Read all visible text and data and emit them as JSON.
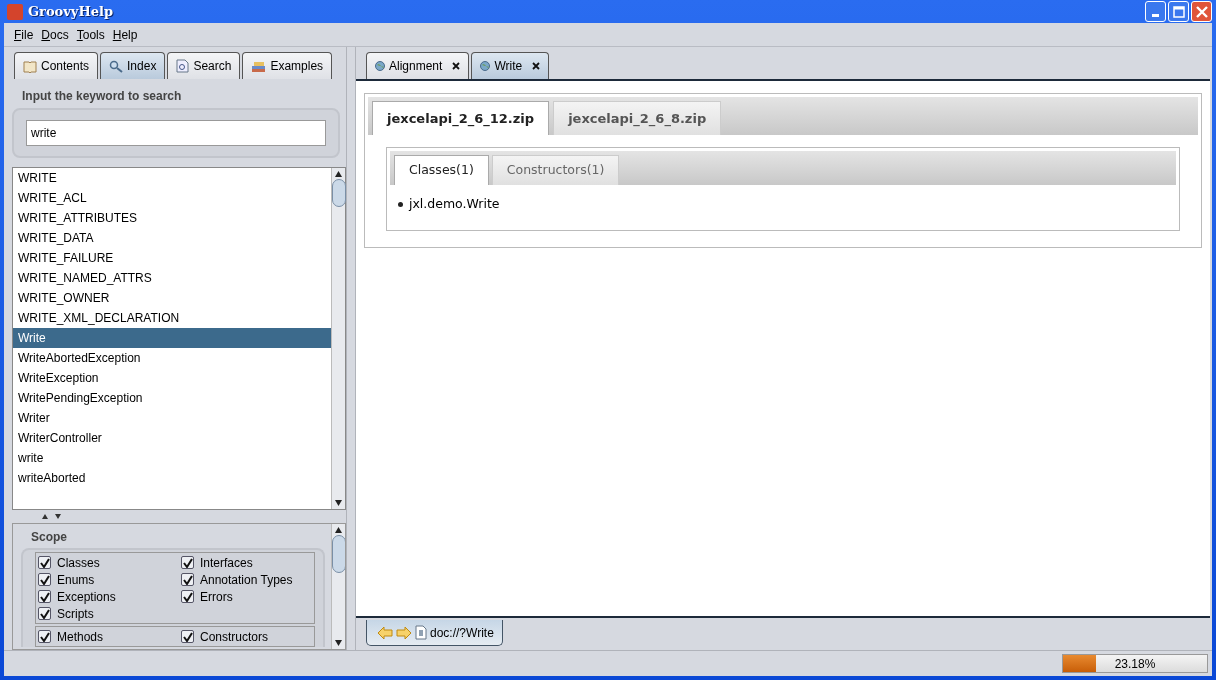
{
  "window": {
    "title": "GroovyHelp"
  },
  "menu": [
    {
      "label": "File"
    },
    {
      "label": "Docs"
    },
    {
      "label": "Tools"
    },
    {
      "label": "Help"
    }
  ],
  "left_tabs": [
    {
      "label": "Contents",
      "selected": false
    },
    {
      "label": "Index",
      "selected": true
    },
    {
      "label": "Search",
      "selected": false
    },
    {
      "label": "Examples",
      "selected": false
    }
  ],
  "search": {
    "label": "Input the keyword to search",
    "value": "write"
  },
  "results": [
    {
      "label": "WRITE",
      "selected": false
    },
    {
      "label": "WRITE_ACL",
      "selected": false
    },
    {
      "label": "WRITE_ATTRIBUTES",
      "selected": false
    },
    {
      "label": "WRITE_DATA",
      "selected": false
    },
    {
      "label": "WRITE_FAILURE",
      "selected": false
    },
    {
      "label": "WRITE_NAMED_ATTRS",
      "selected": false
    },
    {
      "label": "WRITE_OWNER",
      "selected": false
    },
    {
      "label": "WRITE_XML_DECLARATION",
      "selected": false
    },
    {
      "label": "Write",
      "selected": true
    },
    {
      "label": "WriteAbortedException",
      "selected": false
    },
    {
      "label": "WriteException",
      "selected": false
    },
    {
      "label": "WritePendingException",
      "selected": false
    },
    {
      "label": "Writer",
      "selected": false
    },
    {
      "label": "WriterController",
      "selected": false
    },
    {
      "label": "write",
      "selected": false
    },
    {
      "label": "writeAborted",
      "selected": false
    }
  ],
  "scope": {
    "label": "Scope",
    "groups": [
      [
        {
          "label": "Classes",
          "checked": true
        },
        {
          "label": "Interfaces",
          "checked": true
        },
        {
          "label": "Enums",
          "checked": true
        },
        {
          "label": "Annotation Types",
          "checked": true
        },
        {
          "label": "Exceptions",
          "checked": true
        },
        {
          "label": "Errors",
          "checked": true
        },
        {
          "label": "Scripts",
          "checked": true
        }
      ],
      [
        {
          "label": "Methods",
          "checked": true
        },
        {
          "label": "Constructors",
          "checked": true
        }
      ]
    ]
  },
  "doc_tabs": [
    {
      "label": "Alignment",
      "selected": false
    },
    {
      "label": "Write",
      "selected": true
    }
  ],
  "package_tabs": [
    {
      "label": "jexcelapi_2_6_12.zip",
      "selected": true
    },
    {
      "label": "jexcelapi_2_6_8.zip",
      "selected": false
    }
  ],
  "member_tabs": [
    {
      "label": "Classes(1)",
      "selected": true
    },
    {
      "label": "Constructors(1)",
      "selected": false
    }
  ],
  "members": [
    "jxl.demo.Write"
  ],
  "address": {
    "url": "doc://?Write"
  },
  "status_bar": {
    "progress": {
      "level": 0.2318,
      "reading": "23.18%"
    }
  }
}
